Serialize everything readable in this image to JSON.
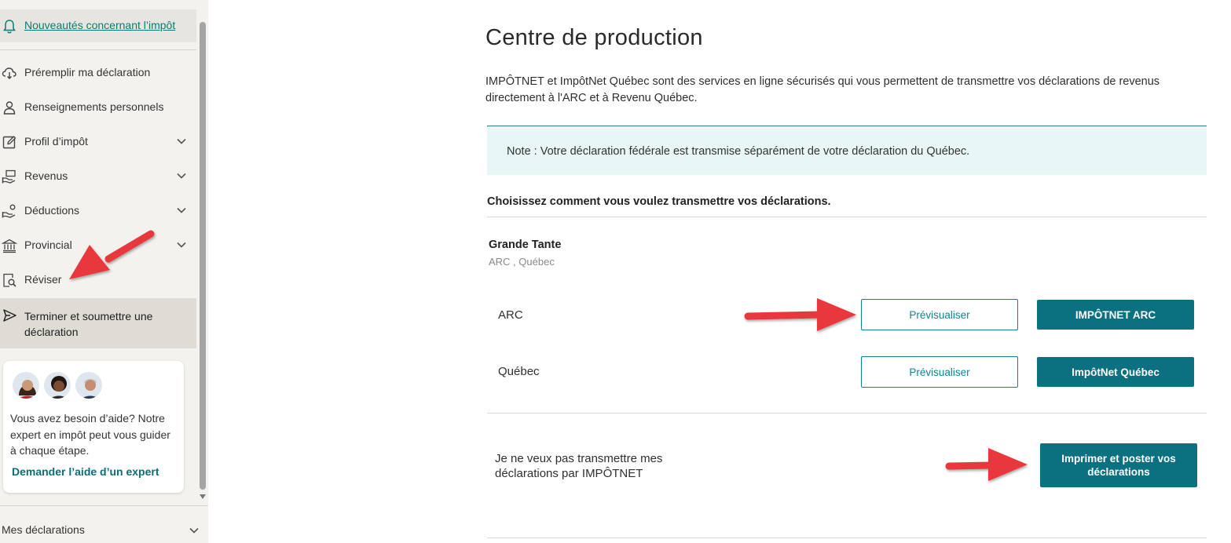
{
  "sidebar": {
    "news_link": "Nouveautés concernant l’impôt",
    "items": [
      {
        "label": "Préremplir ma déclaration",
        "expandable": false
      },
      {
        "label": "Renseignements personnels",
        "expandable": false
      },
      {
        "label": "Profil d’impôt",
        "expandable": true
      },
      {
        "label": "Revenus",
        "expandable": true
      },
      {
        "label": "Déductions",
        "expandable": true
      },
      {
        "label": "Provincial",
        "expandable": true
      },
      {
        "label": "Réviser",
        "expandable": false
      }
    ],
    "active_item": "Terminer et soumettre une déclaration",
    "help": {
      "text": "Vous avez besoin d’aide? Notre expert en impôt peut vous guider à chaque étape.",
      "link": "Demander l’aide d’un expert"
    },
    "bottom_item": "Mes déclarations"
  },
  "main": {
    "title": "Centre de production",
    "intro": "IMPÔTNET et ImpôtNet Québec sont des services en ligne sécurisés qui vous permettent de transmettre vos déclarations de revenus directement à l'ARC et à Revenu Québec.",
    "note": "Note : Votre déclaration fédérale est transmise séparément de votre déclaration du Québec.",
    "choose": "Choisissez comment vous voulez transmettre vos déclarations.",
    "person": {
      "name": "Grande Tante",
      "jurisdictions": "ARC , Québec"
    },
    "rows": [
      {
        "label": "ARC",
        "preview": "Prévisualiser",
        "submit": "IMPÔTNET ARC"
      },
      {
        "label": "Québec",
        "preview": "Prévisualiser",
        "submit": "ImpôtNet Québec"
      }
    ],
    "no_netfile": "Je ne veux pas transmettre mes déclarations par IMPÔTNET",
    "print_button": "Imprimer et poster vos déclarations"
  },
  "colors": {
    "teal": "#0b7080",
    "note_bg": "#e8f6f6",
    "sidebar_bg": "#f3f2ee",
    "annotation_arrow": "#e8383d"
  }
}
